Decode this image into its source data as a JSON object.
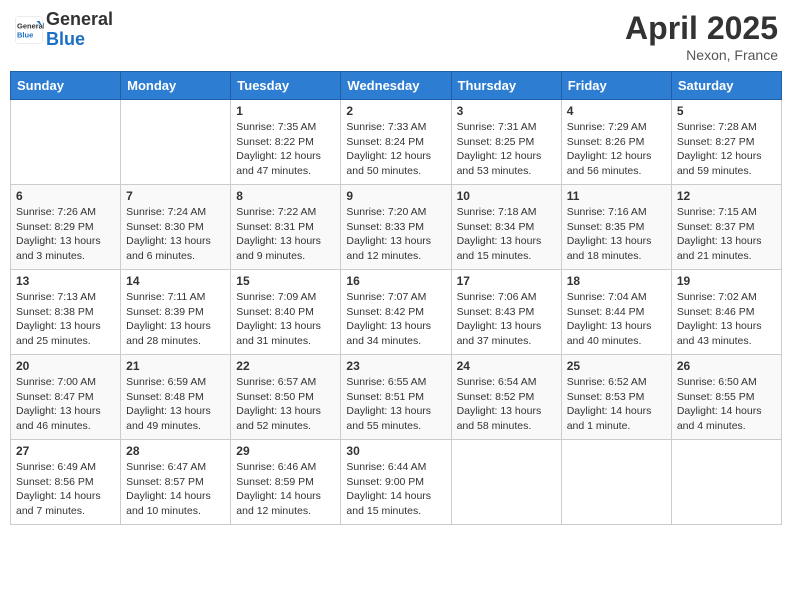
{
  "header": {
    "logo_general": "General",
    "logo_blue": "Blue",
    "month_title": "April 2025",
    "location": "Nexon, France"
  },
  "weekdays": [
    "Sunday",
    "Monday",
    "Tuesday",
    "Wednesday",
    "Thursday",
    "Friday",
    "Saturday"
  ],
  "weeks": [
    [
      null,
      null,
      {
        "day": "1",
        "sunrise": "7:35 AM",
        "sunset": "8:22 PM",
        "daylight": "12 hours and 47 minutes."
      },
      {
        "day": "2",
        "sunrise": "7:33 AM",
        "sunset": "8:24 PM",
        "daylight": "12 hours and 50 minutes."
      },
      {
        "day": "3",
        "sunrise": "7:31 AM",
        "sunset": "8:25 PM",
        "daylight": "12 hours and 53 minutes."
      },
      {
        "day": "4",
        "sunrise": "7:29 AM",
        "sunset": "8:26 PM",
        "daylight": "12 hours and 56 minutes."
      },
      {
        "day": "5",
        "sunrise": "7:28 AM",
        "sunset": "8:27 PM",
        "daylight": "12 hours and 59 minutes."
      }
    ],
    [
      {
        "day": "6",
        "sunrise": "7:26 AM",
        "sunset": "8:29 PM",
        "daylight": "13 hours and 3 minutes."
      },
      {
        "day": "7",
        "sunrise": "7:24 AM",
        "sunset": "8:30 PM",
        "daylight": "13 hours and 6 minutes."
      },
      {
        "day": "8",
        "sunrise": "7:22 AM",
        "sunset": "8:31 PM",
        "daylight": "13 hours and 9 minutes."
      },
      {
        "day": "9",
        "sunrise": "7:20 AM",
        "sunset": "8:33 PM",
        "daylight": "13 hours and 12 minutes."
      },
      {
        "day": "10",
        "sunrise": "7:18 AM",
        "sunset": "8:34 PM",
        "daylight": "13 hours and 15 minutes."
      },
      {
        "day": "11",
        "sunrise": "7:16 AM",
        "sunset": "8:35 PM",
        "daylight": "13 hours and 18 minutes."
      },
      {
        "day": "12",
        "sunrise": "7:15 AM",
        "sunset": "8:37 PM",
        "daylight": "13 hours and 21 minutes."
      }
    ],
    [
      {
        "day": "13",
        "sunrise": "7:13 AM",
        "sunset": "8:38 PM",
        "daylight": "13 hours and 25 minutes."
      },
      {
        "day": "14",
        "sunrise": "7:11 AM",
        "sunset": "8:39 PM",
        "daylight": "13 hours and 28 minutes."
      },
      {
        "day": "15",
        "sunrise": "7:09 AM",
        "sunset": "8:40 PM",
        "daylight": "13 hours and 31 minutes."
      },
      {
        "day": "16",
        "sunrise": "7:07 AM",
        "sunset": "8:42 PM",
        "daylight": "13 hours and 34 minutes."
      },
      {
        "day": "17",
        "sunrise": "7:06 AM",
        "sunset": "8:43 PM",
        "daylight": "13 hours and 37 minutes."
      },
      {
        "day": "18",
        "sunrise": "7:04 AM",
        "sunset": "8:44 PM",
        "daylight": "13 hours and 40 minutes."
      },
      {
        "day": "19",
        "sunrise": "7:02 AM",
        "sunset": "8:46 PM",
        "daylight": "13 hours and 43 minutes."
      }
    ],
    [
      {
        "day": "20",
        "sunrise": "7:00 AM",
        "sunset": "8:47 PM",
        "daylight": "13 hours and 46 minutes."
      },
      {
        "day": "21",
        "sunrise": "6:59 AM",
        "sunset": "8:48 PM",
        "daylight": "13 hours and 49 minutes."
      },
      {
        "day": "22",
        "sunrise": "6:57 AM",
        "sunset": "8:50 PM",
        "daylight": "13 hours and 52 minutes."
      },
      {
        "day": "23",
        "sunrise": "6:55 AM",
        "sunset": "8:51 PM",
        "daylight": "13 hours and 55 minutes."
      },
      {
        "day": "24",
        "sunrise": "6:54 AM",
        "sunset": "8:52 PM",
        "daylight": "13 hours and 58 minutes."
      },
      {
        "day": "25",
        "sunrise": "6:52 AM",
        "sunset": "8:53 PM",
        "daylight": "14 hours and 1 minute."
      },
      {
        "day": "26",
        "sunrise": "6:50 AM",
        "sunset": "8:55 PM",
        "daylight": "14 hours and 4 minutes."
      }
    ],
    [
      {
        "day": "27",
        "sunrise": "6:49 AM",
        "sunset": "8:56 PM",
        "daylight": "14 hours and 7 minutes."
      },
      {
        "day": "28",
        "sunrise": "6:47 AM",
        "sunset": "8:57 PM",
        "daylight": "14 hours and 10 minutes."
      },
      {
        "day": "29",
        "sunrise": "6:46 AM",
        "sunset": "8:59 PM",
        "daylight": "14 hours and 12 minutes."
      },
      {
        "day": "30",
        "sunrise": "6:44 AM",
        "sunset": "9:00 PM",
        "daylight": "14 hours and 15 minutes."
      },
      null,
      null,
      null
    ]
  ],
  "labels": {
    "sunrise": "Sunrise:",
    "sunset": "Sunset:",
    "daylight": "Daylight:"
  }
}
